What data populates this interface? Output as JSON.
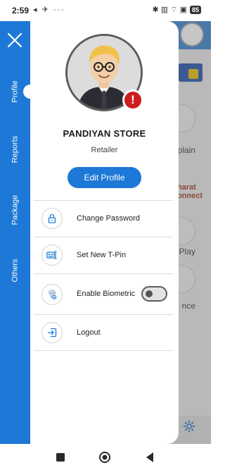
{
  "status_bar": {
    "time": "2:59",
    "left_icons": "◂ ✈ ···",
    "right_icons": "✱ ▥ ⌔ ▣",
    "battery": "85"
  },
  "background": {
    "bg_text_1": "plain",
    "bg_text_2": "Play",
    "bg_text_3": "nce",
    "bg_bharat": "Bharat Connect"
  },
  "rail": {
    "tabs": [
      {
        "label": "Profile"
      },
      {
        "label": "Reports"
      },
      {
        "label": "Package"
      },
      {
        "label": "Others"
      }
    ]
  },
  "profile": {
    "name": "PANDIYAN STORE",
    "role": "Retailer",
    "edit_label": "Edit Profile",
    "badge": "!"
  },
  "menu": {
    "items": [
      {
        "label": "Change Password",
        "icon": "lock-icon"
      },
      {
        "label": "Set New T-Pin",
        "icon": "pin-keypad-icon"
      },
      {
        "label": "Enable Biometric",
        "icon": "fingerprint-icon",
        "toggle": false
      },
      {
        "label": "Logout",
        "icon": "logout-icon"
      }
    ]
  },
  "colors": {
    "primary": "#1e78d7",
    "alert": "#cc1f1f"
  }
}
